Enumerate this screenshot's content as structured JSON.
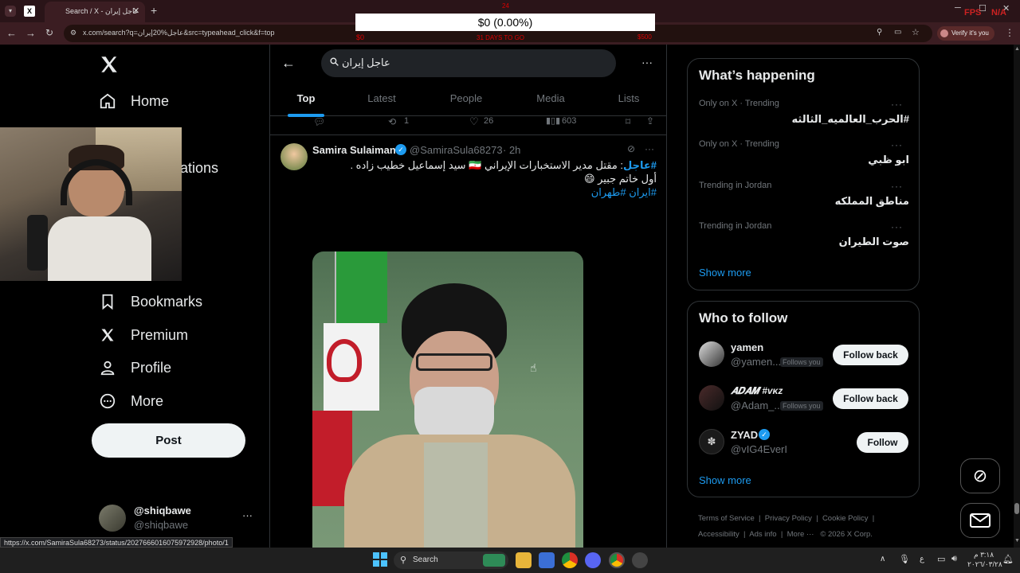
{
  "browser": {
    "tab_title": "Search / X - عاجل إيران",
    "url": "x.com/search?q=عاجل%20إيران&src=typeahead_click&f=top",
    "verify_label": "Verify it's you",
    "status_url": "https://x.com/SamiraSula68273/status/2027666016075972928/photo/1"
  },
  "overlay": {
    "amount": "$0 (0.00%)",
    "left_value": "$0",
    "center_label": "31 DAYS TO GO",
    "right_value": "$500",
    "top_value": "24",
    "fps": "FPS",
    "na": "N/A"
  },
  "nav": {
    "home": "Home",
    "notifications_partial": "ations",
    "bookmarks": "Bookmarks",
    "premium": "Premium",
    "profile": "Profile",
    "more": "More",
    "post": "Post",
    "account_name": "@shiqbawe",
    "account_handle": "@shiqbawe"
  },
  "search": {
    "query": "عاجل إيران",
    "tabs": [
      "Top",
      "Latest",
      "People",
      "Media",
      "Lists"
    ],
    "active_tab": "Top"
  },
  "prev_tweet_actions": {
    "retweets": "1",
    "likes": "26",
    "views": "603"
  },
  "tweet": {
    "name": "Samira Sulaiman",
    "handle": "@SamiraSula68273",
    "time": "· 2h",
    "hashtag1": "#عاجل",
    "line1": ": مقتل مدير الاستخبارات الإيراني 🇮🇷 سيد إسماعيل خطيب زاده .",
    "line2": "أول خاتم جبير 😄",
    "hashtag_line": "#ايران #طهران"
  },
  "happening": {
    "title": "What’s happening",
    "trends": [
      {
        "meta": "Only on X · Trending",
        "name": "#الحرب_العالميه_الثالثه"
      },
      {
        "meta": "Only on X · Trending",
        "name": "ابو ظبي"
      },
      {
        "meta": "Trending in Jordan",
        "name": "مناطق المملكه"
      },
      {
        "meta": "Trending in Jordan",
        "name": "صوت الطيران"
      }
    ],
    "show_more": "Show more"
  },
  "who_to_follow": {
    "title": "Who to follow",
    "users": [
      {
        "name": "yamen",
        "handle": "@yamen...",
        "badge": "Follows you",
        "action": "Follow back"
      },
      {
        "name": "𝑨𝑫𝑨𝑴 #ᴠᴋᴢ",
        "handle": "@Adam_...",
        "badge": "Follows you",
        "action": "Follow back"
      },
      {
        "name": "ZYAD",
        "handle": "@vIG4EverI",
        "badge": "",
        "action": "Follow"
      }
    ],
    "show_more": "Show more"
  },
  "footer": {
    "terms": "Terms of Service",
    "privacy": "Privacy Policy",
    "cookie": "Cookie Policy",
    "accessibility": "Accessibility",
    "ads": "Ads info",
    "more": "More ···",
    "copyright": "© 2026 X Corp."
  },
  "taskbar": {
    "search_label": "Search",
    "time": "٣:١٨ م",
    "date": "٢٠٢٦/٠٣/٢٨",
    "lang": "ع"
  },
  "colors": {
    "accent": "#1d9bf0",
    "background": "#000000",
    "border": "#2f3336",
    "muted": "#71767b"
  }
}
